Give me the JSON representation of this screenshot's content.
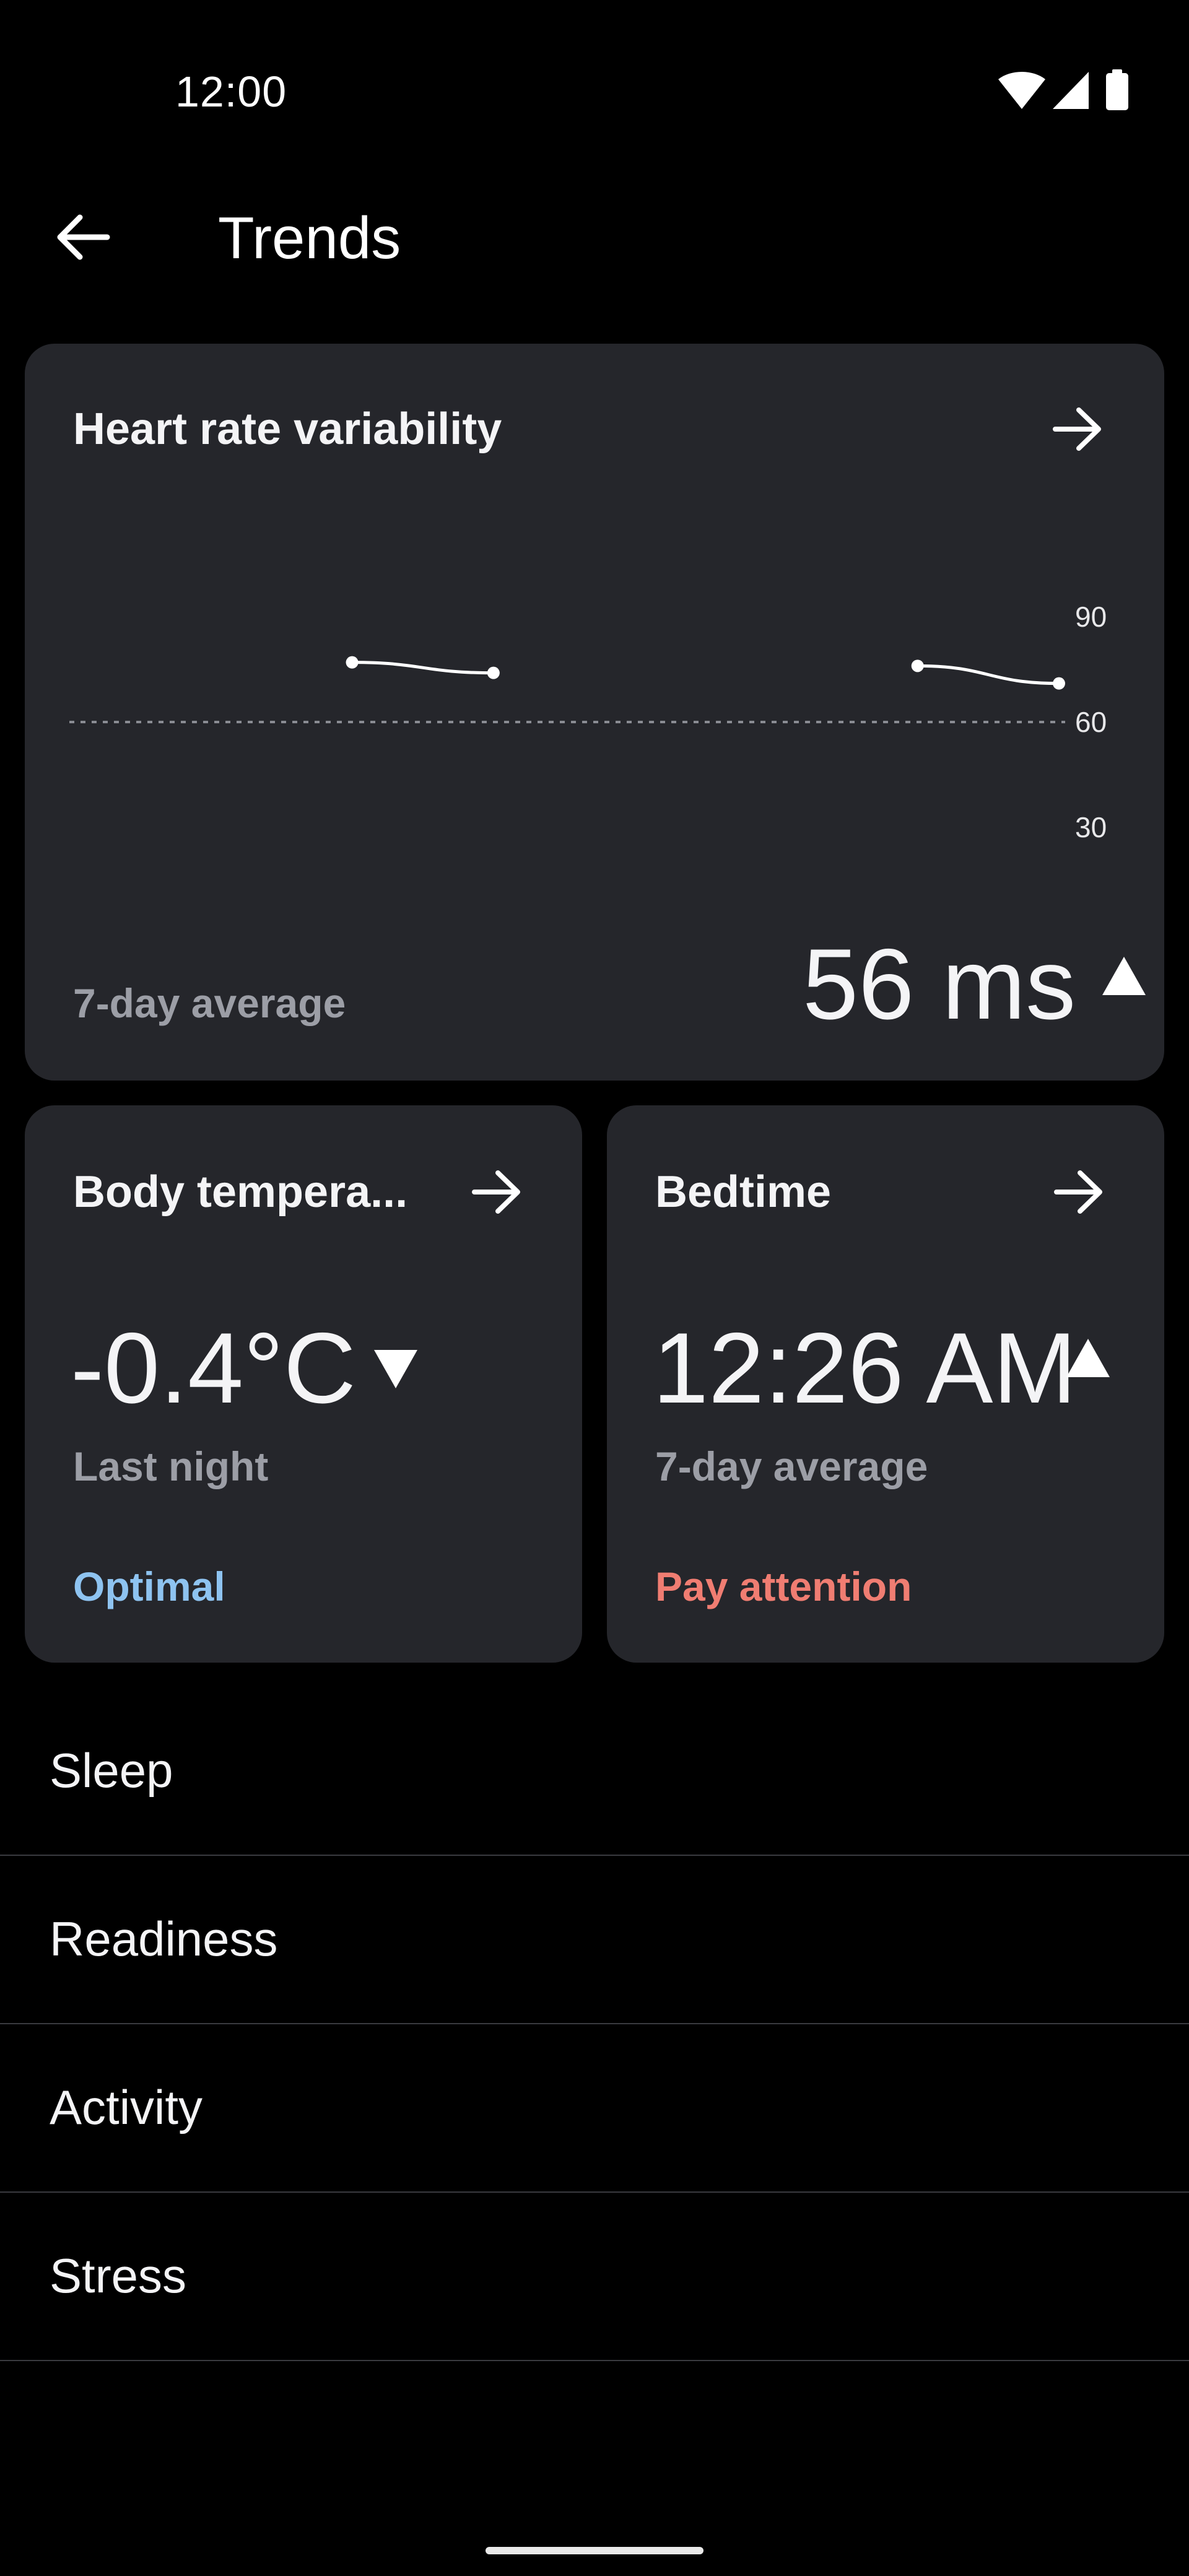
{
  "status_bar": {
    "time": "12:00",
    "icons": [
      "wifi-icon",
      "cellular-signal-icon",
      "battery-icon"
    ]
  },
  "app_bar": {
    "back_icon": "arrow-left-icon",
    "title": "Trends"
  },
  "hrv_card": {
    "title": "Heart rate variability",
    "arrow_icon": "arrow-right-icon",
    "caption": "7-day average",
    "value": "56 ms",
    "trend_icon": "triangle-up-icon",
    "y_ticks": [
      "90",
      "60",
      "30"
    ],
    "chart_data": {
      "type": "line",
      "y_ticks": [
        90,
        60,
        30
      ],
      "reference_value": 60,
      "segments": [
        [
          {
            "x": 2,
            "y": 77
          },
          {
            "x": 3,
            "y": 74
          }
        ],
        [
          {
            "x": 6,
            "y": 76
          },
          {
            "x": 7,
            "y": 71
          }
        ]
      ]
    }
  },
  "temperature_card": {
    "title": "Body tempera...",
    "arrow_icon": "arrow-right-icon",
    "value": "-0.4°C",
    "trend_icon": "triangle-down-icon",
    "caption": "Last night",
    "status": "Optimal"
  },
  "bedtime_card": {
    "title": "Bedtime",
    "arrow_icon": "arrow-right-icon",
    "value": "12:26 AM",
    "trend_icon": "triangle-up-icon",
    "caption": "7-day average",
    "status": "Pay attention"
  },
  "nav_list": {
    "items": [
      {
        "label": "Sleep"
      },
      {
        "label": "Readiness"
      },
      {
        "label": "Activity"
      },
      {
        "label": "Stress"
      }
    ]
  },
  "colors": {
    "background": "#000000",
    "card": "#25262b",
    "muted_text": "#9c9ea6",
    "optimal": "#8ec3f0",
    "pay_attention": "#f07d72"
  }
}
